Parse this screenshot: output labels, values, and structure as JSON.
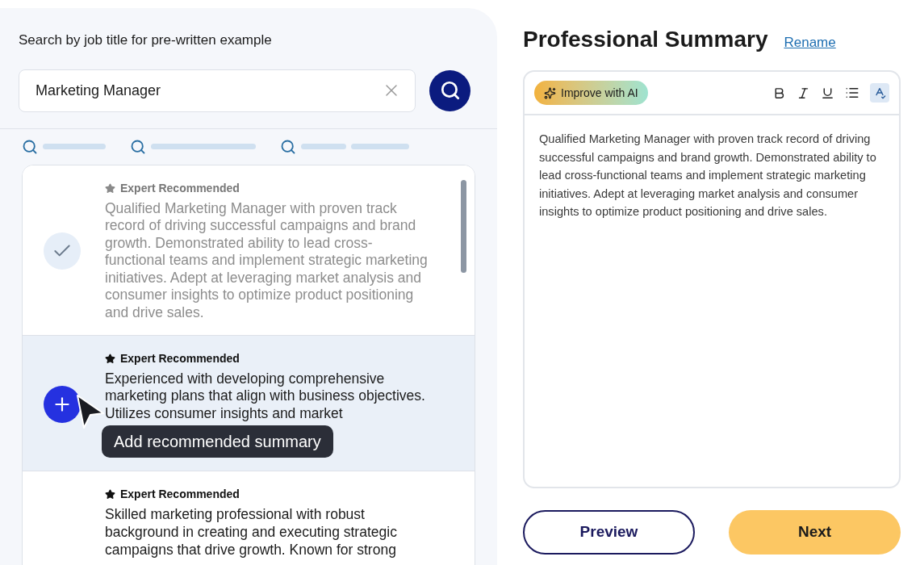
{
  "search": {
    "label": "Search by job title for pre-written example",
    "value": "Marketing Manager"
  },
  "suggestions": {
    "loading": true
  },
  "examples": [
    {
      "badge": "Expert Recommended",
      "text": "Qualified Marketing Manager with proven track record of driving successful campaigns and brand growth. Demonstrated ability to lead cross-functional teams and implement strategic marketing initiatives. Adept at leveraging market analysis and consumer insights to optimize product positioning and drive sales.",
      "added": true,
      "hovered": false
    },
    {
      "badge": "Expert Recommended",
      "text": "Experienced with developing comprehensive marketing plans that align with business objectives. Utilizes consumer insights and market",
      "added": false,
      "hovered": true,
      "tooltip": "Add recommended summary"
    },
    {
      "badge": "Expert Recommended",
      "text": "Skilled marketing professional with robust background in creating and executing strategic campaigns that drive growth. Known for strong",
      "added": false,
      "hovered": false
    }
  ],
  "editor": {
    "title": "Professional Summary",
    "rename": "Rename",
    "ai_button": "Improve with AI",
    "spellcheck_on": true,
    "content": "Qualified Marketing Manager with proven track record of driving successful campaigns and brand growth. Demonstrated ability to lead cross-functional teams and implement strategic marketing initiatives. Adept at leveraging market analysis and consumer insights to optimize product positioning and drive sales."
  },
  "buttons": {
    "preview": "Preview",
    "next": "Next"
  }
}
